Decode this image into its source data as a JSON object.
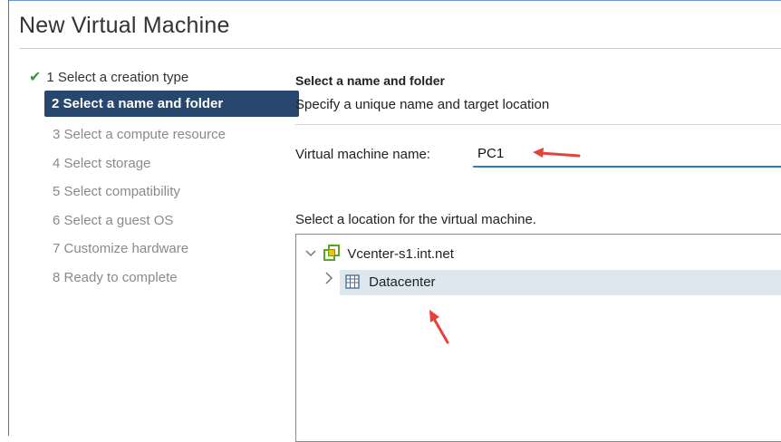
{
  "dialog": {
    "title": "New Virtual Machine"
  },
  "steps": [
    {
      "label": "1 Select a creation type",
      "state": "done"
    },
    {
      "label": "2 Select a name and folder",
      "state": "active"
    },
    {
      "label": "3 Select a compute resource",
      "state": "pending"
    },
    {
      "label": "4 Select storage",
      "state": "pending"
    },
    {
      "label": "5 Select compatibility",
      "state": "pending"
    },
    {
      "label": "6 Select a guest OS",
      "state": "pending"
    },
    {
      "label": "7 Customize hardware",
      "state": "pending"
    },
    {
      "label": "8 Ready to complete",
      "state": "pending"
    }
  ],
  "content": {
    "heading": "Select a name and folder",
    "subheading": "Specify a unique name and target location",
    "vm_name_label": "Virtual machine name:",
    "vm_name_value": "PC1",
    "location_label": "Select a location for the virtual machine."
  },
  "tree": {
    "root_label": "Vcenter-s1.int.net",
    "child_label": "Datacenter"
  },
  "colors": {
    "active_step_bg": "#27476e",
    "check": "#2e9c3c",
    "arrow": "#e8413a",
    "selected_row": "#dce7ee",
    "input_underline": "#2b7bc0"
  },
  "icons": {
    "check": "checkmark-icon",
    "vcenter": "vcenter-icon",
    "datacenter": "datacenter-icon"
  }
}
